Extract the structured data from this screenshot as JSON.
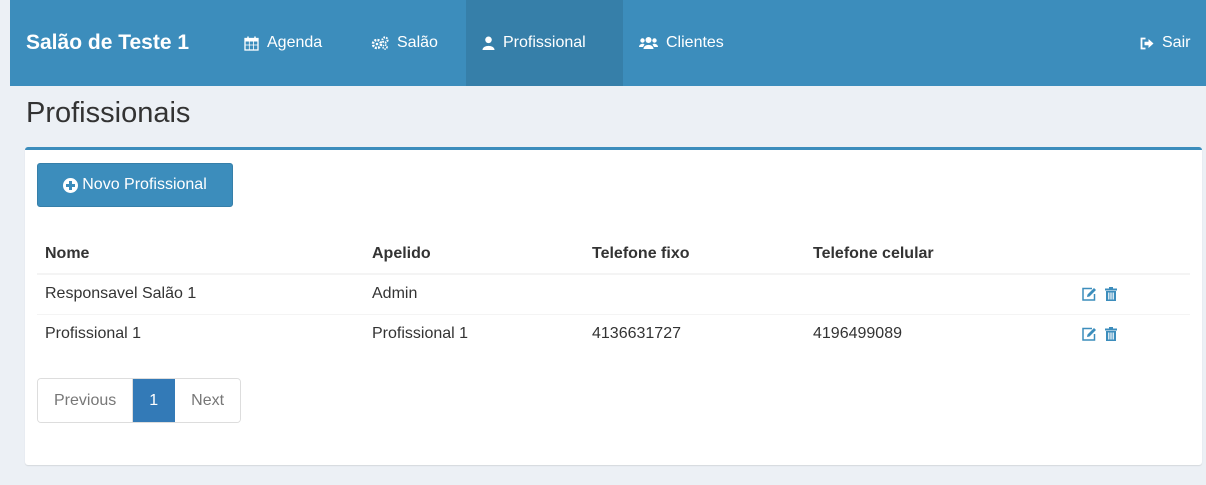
{
  "navbar": {
    "brand": "Salão de Teste 1",
    "items": [
      {
        "label": "Agenda",
        "icon": "calendar-icon",
        "active": false
      },
      {
        "label": "Salão",
        "icon": "cogs-icon",
        "active": false
      },
      {
        "label": "Profissional",
        "icon": "user-icon",
        "active": true
      },
      {
        "label": "Clientes",
        "icon": "users-icon",
        "active": false
      }
    ],
    "logout": {
      "label": "Sair",
      "icon": "sign-out-icon"
    }
  },
  "page": {
    "title": "Profissionais"
  },
  "actions": {
    "new_label": "Novo Profissional"
  },
  "table": {
    "headers": [
      "Nome",
      "Apelido",
      "Telefone fixo",
      "Telefone celular"
    ],
    "rows": [
      {
        "nome": "Responsavel Salão 1",
        "apelido": "Admin",
        "fixo": "",
        "celular": ""
      },
      {
        "nome": "Profissional 1",
        "apelido": "Profissional 1",
        "fixo": "4136631727",
        "celular": "4196499089"
      }
    ]
  },
  "pagination": {
    "previous": "Previous",
    "current": "1",
    "next": "Next"
  },
  "colors": {
    "primary": "#3c8dbc",
    "primary_dark": "#367fa9",
    "page_active": "#337ab7",
    "background": "#ecf0f5"
  }
}
